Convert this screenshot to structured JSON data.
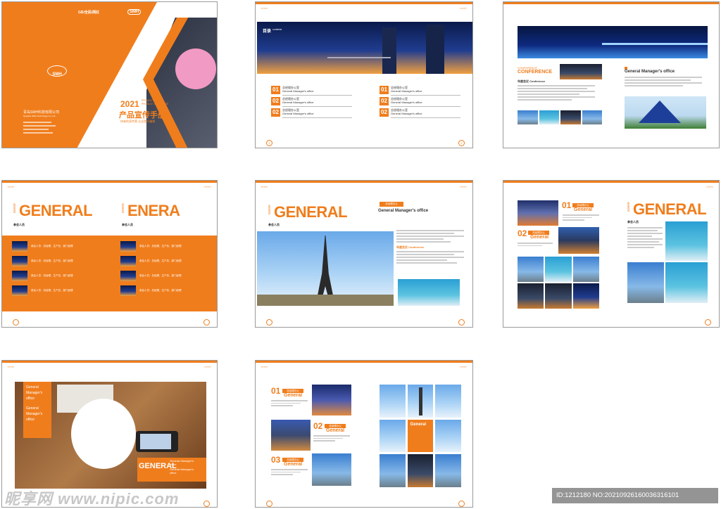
{
  "p1": {
    "logo": "SMH",
    "top_badge": "GB/全民/网红",
    "top_logo": "SMH",
    "year": "2021",
    "product_en_1": "PRODUCT",
    "product_en_2": "PRODUCT BROCHURE",
    "title_cn": "产品宣传手册",
    "subtitle_cn": "持有的宣传营 企业提升编辑",
    "company_cn": "青岛SMH科技有限公司",
    "company_en": "Qingdao SMH Technology Co.,Ltd"
  },
  "p2": {
    "toc_label": "目录",
    "toc_en": "contents",
    "items": [
      {
        "num": "01",
        "cn": "总经理办公室",
        "en": "General Manager's office"
      },
      {
        "num": "02",
        "cn": "总经理办公室",
        "en": "General Manager's office"
      },
      {
        "num": "02",
        "cn": "总经理办公室",
        "en": "General Manager's office"
      },
      {
        "num": "01",
        "cn": "总经理办公室",
        "en": "General Manager's office"
      },
      {
        "num": "02",
        "cn": "总经理办公室",
        "en": "General Manager's office"
      },
      {
        "num": "02",
        "cn": "总经理办公室",
        "en": "General Manager's office"
      }
    ],
    "page_left": "1",
    "page_right": "2"
  },
  "p3": {
    "conf_small": "CONFERENCE",
    "conf_big": "CONFERENCE",
    "annual_label": "年度会议",
    "annual_en": "Conference",
    "gm_title": "General Manager's office"
  },
  "p4": {
    "label_small": "会议内容",
    "big_left": "GENERAL",
    "big_right": "ENERA",
    "attendees": "参会人员",
    "rows": [
      "参会人员：总经理、生产总、部门经理",
      "参会人员：总经理、生产总、部门经理",
      "参会人员：总经理、生产总、部门经理",
      "参会人员：总经理、生产总、部门经理"
    ]
  },
  "p5": {
    "label_small": "会议内容",
    "big": "GENERAL",
    "attendees": "参会人员",
    "tag": "总经理办公",
    "gm_title": "General Manager's office",
    "annual_label": "年度会议",
    "annual_en": "Conference"
  },
  "p6": {
    "n1": "01",
    "tag1": "总经理办公",
    "g1": "General",
    "n2": "02",
    "tag2": "总经理办公",
    "g2": "General",
    "big": "GENERAL",
    "attendees": "参会人员"
  },
  "p7": {
    "box_lines": [
      "General",
      "Manager's",
      "office",
      "General",
      "Manager's",
      "office"
    ],
    "big": "GENERAL",
    "gm_1": "General Manager's",
    "gm_2": "office",
    "gm_3": "General Manager's",
    "gm_4": "office"
  },
  "p8": {
    "n1": "01",
    "tag1": "总经理办公",
    "g1": "General",
    "n2": "02",
    "tag2": "总经理办公",
    "g2": "General",
    "n3": "03",
    "tag3": "总经理办公",
    "g3": "General",
    "g4": "General"
  },
  "watermark": {
    "site": "昵享网 www.nipic.com",
    "id_text": "ID:1212180 NO:20210926160036316101"
  },
  "colors": {
    "accent": "#f07d1c"
  }
}
